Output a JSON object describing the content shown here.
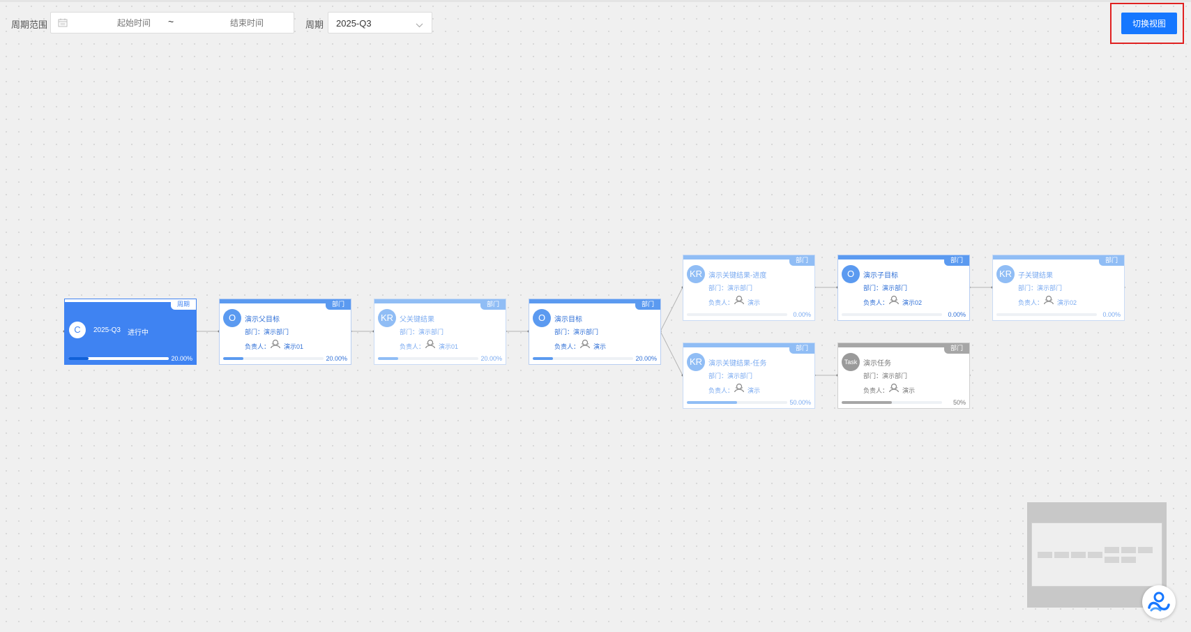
{
  "toolbar": {
    "range_label": "周期范围",
    "start_placeholder": "起始时间",
    "separator": "~",
    "end_placeholder": "结束时间",
    "period_label": "周期",
    "period_value": "2025-Q3",
    "switch_view_label": "切换视图"
  },
  "nodes": {
    "cycle": {
      "tag": "周期",
      "avatar": "C",
      "title": "2025-Q3",
      "status": "进行中",
      "progress": 0.2,
      "percent": "20.00%"
    },
    "parent_objective": {
      "tag": "部门",
      "avatar": "O",
      "title": "演示父目标",
      "dept": "部门：演示部门",
      "owner_label": "负责人：",
      "owner": "演示01",
      "progress": 0.2,
      "percent": "20.00%"
    },
    "parent_kr": {
      "tag": "部门",
      "avatar": "KR",
      "title": "父关键结果",
      "dept": "部门：演示部门",
      "owner_label": "负责人：",
      "owner": "演示01",
      "progress": 0.2,
      "percent": "20.00%"
    },
    "objective": {
      "tag": "部门",
      "avatar": "O",
      "title": "演示目标",
      "dept": "部门：演示部门",
      "owner_label": "负责人：",
      "owner": "演示",
      "progress": 0.2,
      "percent": "20.00%"
    },
    "kr_progress": {
      "tag": "部门",
      "avatar": "KR",
      "title": "演示关键结果-进度",
      "dept": "部门：演示部门",
      "owner_label": "负责人：",
      "owner": "演示",
      "progress": 0.0,
      "percent": "0.00%"
    },
    "kr_task": {
      "tag": "部门",
      "avatar": "KR",
      "title": "演示关键结果-任务",
      "dept": "部门：演示部门",
      "owner_label": "负责人：",
      "owner": "演示",
      "progress": 0.5,
      "percent": "50.00%"
    },
    "child_objective": {
      "tag": "部门",
      "avatar": "O",
      "title": "演示子目标",
      "dept": "部门：演示部门",
      "owner_label": "负责人：",
      "owner": "演示02",
      "progress": 0.0,
      "percent": "0.00%"
    },
    "child_kr": {
      "tag": "部门",
      "avatar": "KR",
      "title": "子关键结果",
      "dept": "部门：演示部门",
      "owner_label": "负责人：",
      "owner": "演示02",
      "progress": 0.0,
      "percent": "0.00%"
    },
    "task": {
      "tag": "部门",
      "avatar": "Task",
      "title": "演示任务",
      "dept": "部门：演示部门",
      "owner_label": "负责人：",
      "owner": "演示",
      "progress": 0.5,
      "percent": "50%"
    }
  },
  "colors": {
    "primary": "#1677ff",
    "node_active": "#5b9af0",
    "node_light": "#90bdf5",
    "node_task": "#a6a6a6",
    "cycle_bg": "#3f83f2"
  }
}
